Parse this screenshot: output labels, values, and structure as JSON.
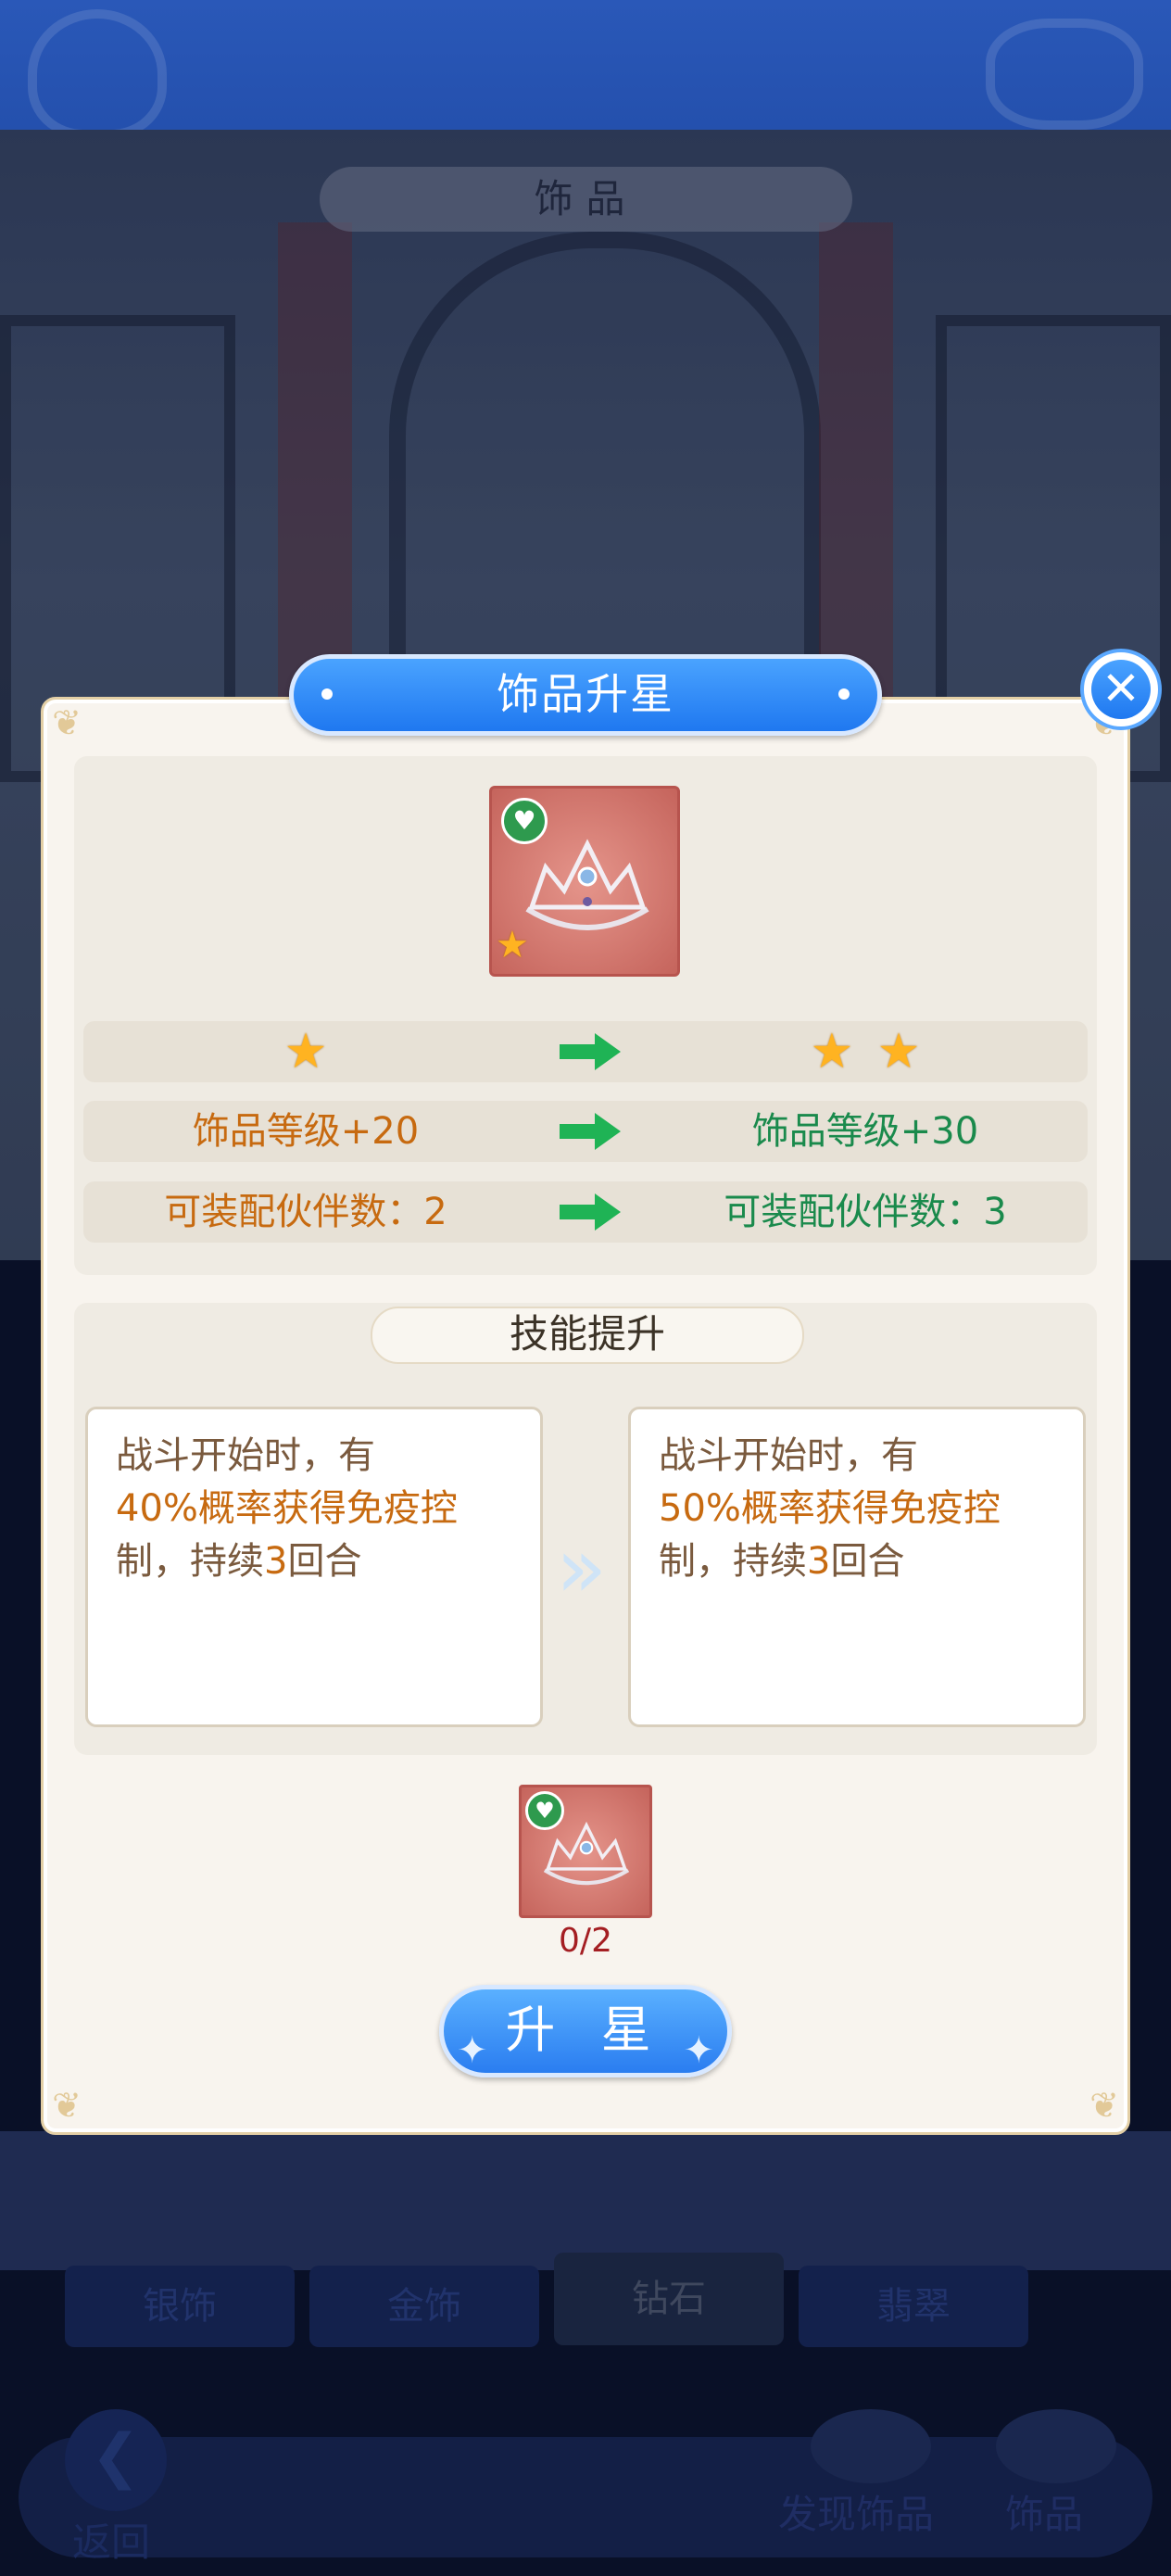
{
  "screen": {
    "title": "饰品",
    "tabs": [
      "银饰",
      "金饰",
      "钻石",
      "翡翠"
    ],
    "active_tab": "钻石",
    "bottom": {
      "back": "返回",
      "discover": "发现饰品",
      "accessory": "饰品"
    }
  },
  "dialog": {
    "title": "饰品升星",
    "close_icon": "close-icon",
    "comparison": [
      {
        "left_stars": 1,
        "right_stars": 2
      },
      {
        "left": "饰品等级+20",
        "right": "饰品等级+30"
      },
      {
        "left": "可装配伙伴数：2",
        "right": "可装配伙伴数：3"
      }
    ],
    "skill_title": "技能提升",
    "skill_before": {
      "pre": "战斗开始时，有",
      "hl": "40%概率获得免疫控",
      "post1": "制，持续",
      "num": "3",
      "post2": "回合"
    },
    "skill_after": {
      "pre": "战斗开始时，有",
      "hl": "50%概率获得免疫控",
      "post1": "制，持续",
      "num": "3",
      "post2": "回合"
    },
    "material_count": "0/2",
    "upgrade_button": "升 星"
  },
  "colors": {
    "accent_blue": "#1f78f0",
    "old_value": "#c76a10",
    "new_value": "#1a8a4c",
    "count_red": "#a41e22"
  }
}
